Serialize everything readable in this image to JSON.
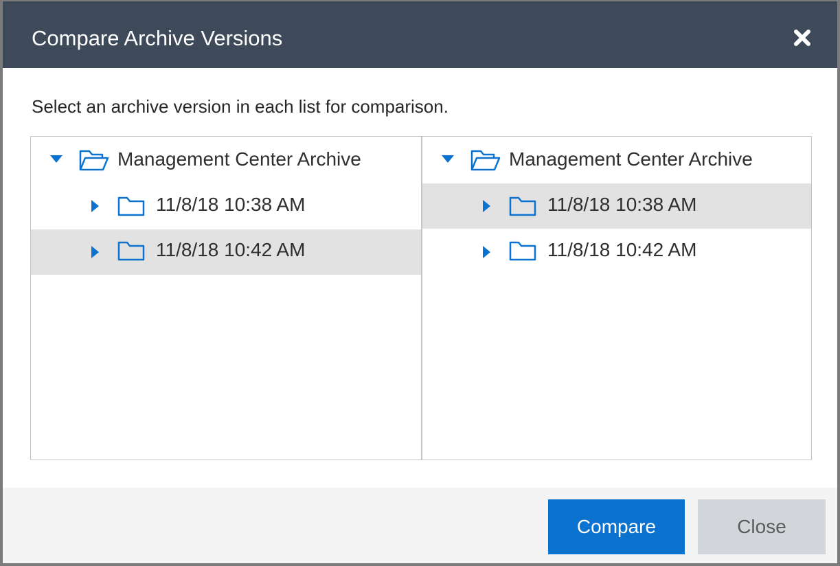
{
  "dialog": {
    "title": "Compare Archive Versions",
    "close_icon": "close-icon",
    "instructions": "Select an archive version in each list for comparison."
  },
  "left_list": {
    "root": {
      "label": "Management Center Archive",
      "expanded": true,
      "icon": "folder-open-icon"
    },
    "items": [
      {
        "label": "11/8/18 10:38 AM",
        "selected": false,
        "icon": "folder-icon"
      },
      {
        "label": "11/8/18 10:42 AM",
        "selected": true,
        "icon": "folder-icon"
      }
    ]
  },
  "right_list": {
    "root": {
      "label": "Management Center Archive",
      "expanded": true,
      "icon": "folder-open-icon"
    },
    "items": [
      {
        "label": "11/8/18 10:38 AM",
        "selected": true,
        "icon": "folder-icon"
      },
      {
        "label": "11/8/18 10:42 AM",
        "selected": false,
        "icon": "folder-icon"
      }
    ]
  },
  "buttons": {
    "compare_label": "Compare",
    "close_label": "Close"
  },
  "colors": {
    "titlebar": "#3e4a5a",
    "accent": "#0b73cf",
    "selected_row": "#e2e2e2",
    "close_button": "#d2d6da"
  }
}
